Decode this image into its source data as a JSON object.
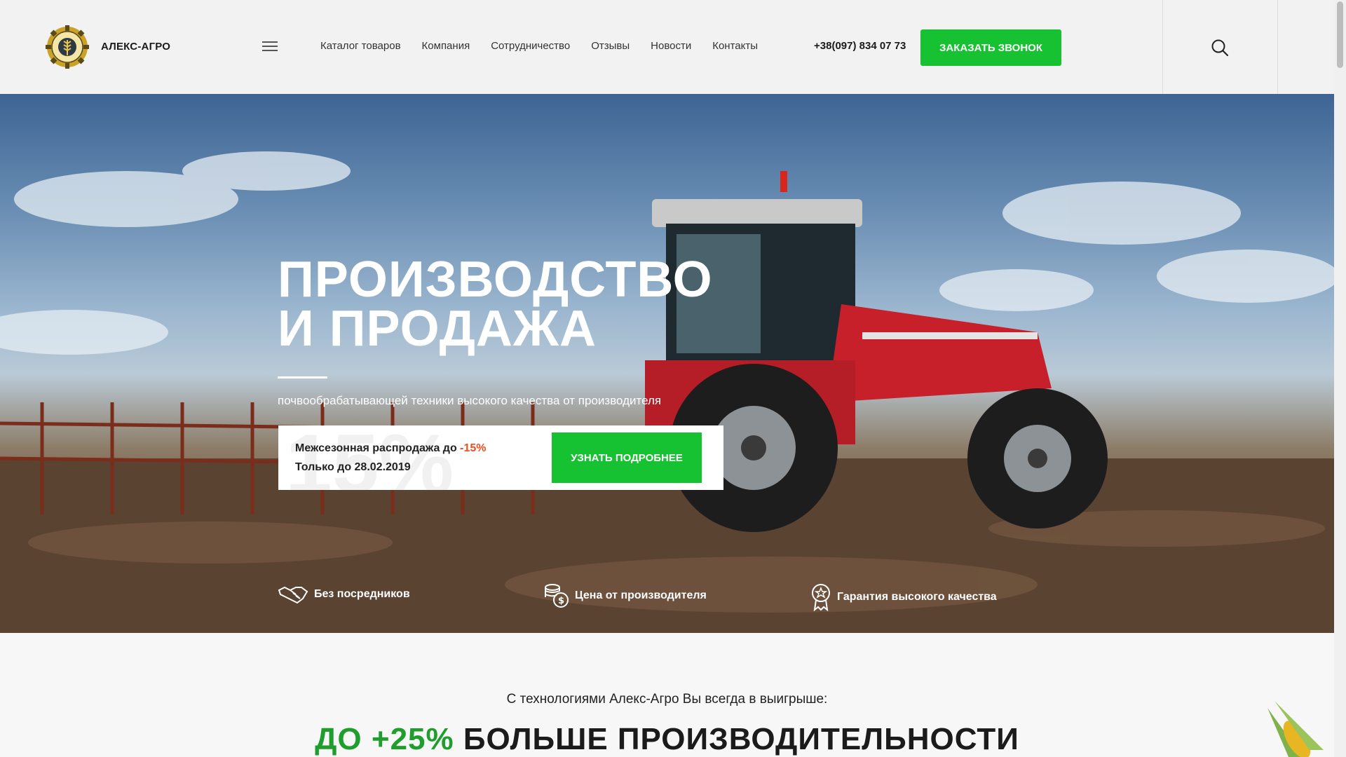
{
  "header": {
    "brand": "АЛЕКС-АГРО",
    "logo_text": "АЛЕКС АГРО",
    "nav": [
      "Каталог товаров",
      "Компания",
      "Сотрудничество",
      "Отзывы",
      "Новости",
      "Контакты"
    ],
    "phone": "+38(097) 834 07 73",
    "call_button": "ЗАКАЗАТЬ ЗВОНОК",
    "icons": {
      "menu": "hamburger-menu-icon",
      "search": "search-icon"
    }
  },
  "hero": {
    "title_line1": "ПРОИЗВОДСТВО",
    "title_line2": "И ПРОДАЖА",
    "subtitle": "почвообрабатывающей техники высокого качества от производителя",
    "promo": {
      "background_text": "15%",
      "line1_prefix": "Межсезонная распродажа до ",
      "line1_discount": "-15%",
      "line2": "Только до 28.02.2019",
      "button": "УЗНАТЬ ПОДРОБНЕЕ"
    },
    "features": [
      {
        "icon": "handshake-icon",
        "label": "Без посредников"
      },
      {
        "icon": "coins-icon",
        "label": "Цена от производителя"
      },
      {
        "icon": "award-badge-icon",
        "label": "Гарантия высокого качества"
      }
    ]
  },
  "benefits": {
    "intro": "С технологиями Алекс-Агро Вы всегда в выигрыше:",
    "headline_accent": "ДО +25%",
    "headline_rest": "БОЛЬШЕ ПРОИЗВОДИТЕЛЬНОСТИ"
  },
  "colors": {
    "accent_green": "#16c132",
    "discount_orange": "#ef4d1f",
    "headline_green": "#1f9e2e"
  }
}
